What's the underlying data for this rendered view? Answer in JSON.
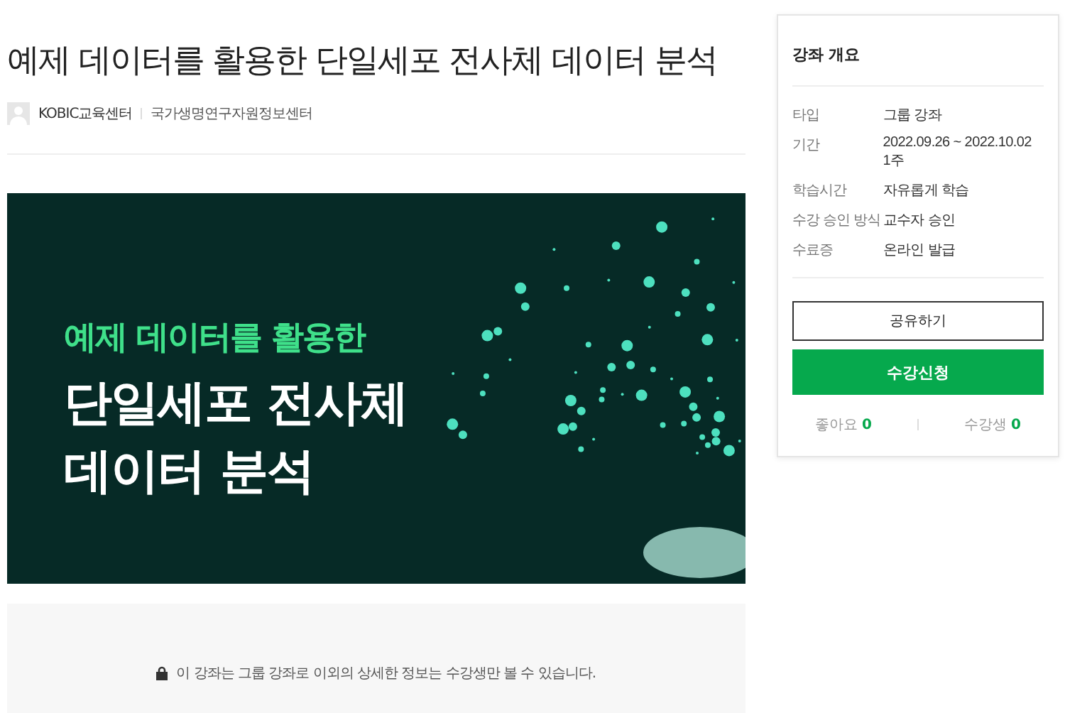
{
  "title": "예제 데이터를 활용한 단일세포 전사체 데이터 분석",
  "author": {
    "name": "KOBIC교육센터",
    "organization": "국가생명연구자원정보센터"
  },
  "banner": {
    "subtitle": "예제 데이터를 활용한",
    "headline": [
      "단일세포 전사체",
      "데이터 분석"
    ]
  },
  "notice": "이 강좌는 그룹 강좌로 이외의 상세한 정보는 수강생만 볼 수 있습니다.",
  "overview": {
    "title": "강좌 개요",
    "rows": [
      {
        "label": "타입",
        "value": [
          "그룹 강좌"
        ]
      },
      {
        "label": "기간",
        "value": [
          "2022.09.26 ~ 2022.10.02",
          "1주"
        ]
      },
      {
        "label": "학습시간",
        "value": [
          "자유롭게 학습"
        ]
      },
      {
        "label": "수강 승인 방식",
        "value": [
          "교수자 승인"
        ]
      },
      {
        "label": "수료증",
        "value": [
          "온라인 발급"
        ]
      }
    ],
    "share_button": "공유하기",
    "enroll_button": "수강신청",
    "stats": [
      {
        "label": "좋아요",
        "count": "0"
      },
      {
        "label": "수강생",
        "count": "0"
      }
    ]
  }
}
